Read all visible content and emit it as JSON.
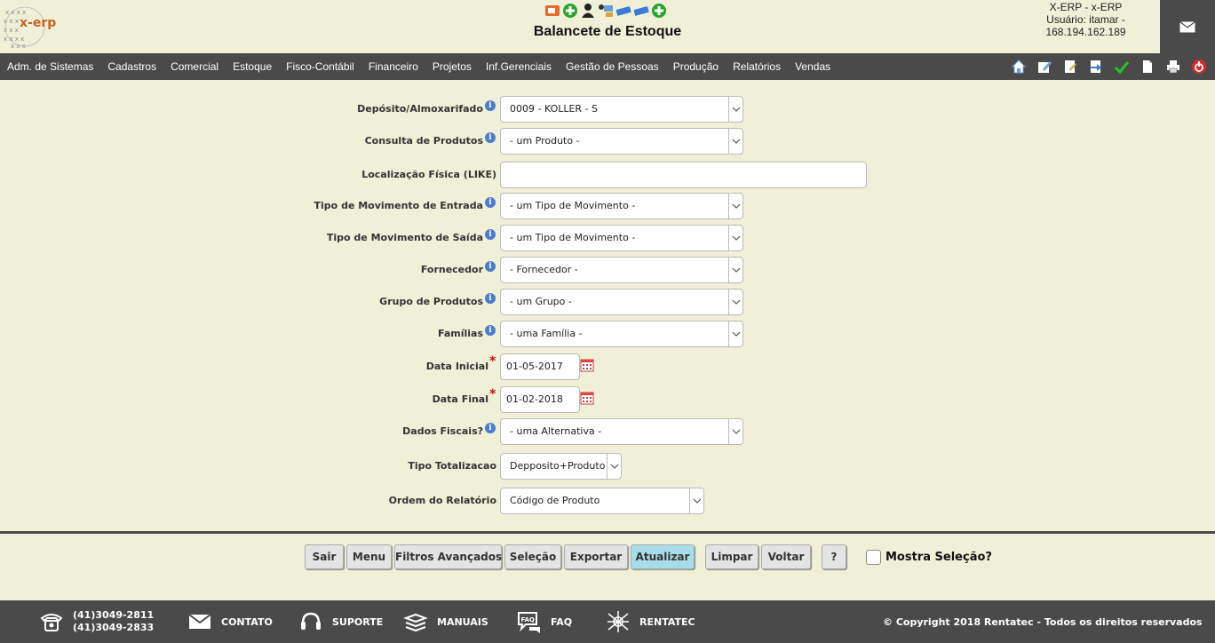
{
  "header": {
    "logo_text": "x-erp",
    "title": "Balancete de Estoque",
    "user_line1": "X-ERP - x-ERP",
    "user_line2": "Usuário: itamar -",
    "user_line3": "168.194.162.189"
  },
  "menu": {
    "items": [
      "Adm. de Sistemas",
      "Cadastros",
      "Comercial",
      "Estoque",
      "Fisco-Contábil",
      "Financeiro",
      "Projetos",
      "Inf.Gerenciais",
      "Gestão de Pessoas",
      "Produção",
      "Relatórios",
      "Vendas"
    ]
  },
  "form": {
    "deposito": {
      "label": "Depósito/Almoxarifado",
      "value": "0009 - KOLLER - S"
    },
    "consulta": {
      "label": "Consulta de Produtos",
      "value": "- um Produto -"
    },
    "localizacao": {
      "label": "Localização Física (LIKE)",
      "value": ""
    },
    "mov_entrada": {
      "label": "Tipo de Movimento de Entrada",
      "value": "- um Tipo de Movimento -"
    },
    "mov_saida": {
      "label": "Tipo de Movimento de Saída",
      "value": "- um Tipo de Movimento -"
    },
    "fornecedor": {
      "label": "Fornecedor",
      "value": "- Fornecedor -"
    },
    "grupo": {
      "label": "Grupo de Produtos",
      "value": "- um Grupo -"
    },
    "familias": {
      "label": "Famílias",
      "value": "- uma Família -"
    },
    "data_inicial": {
      "label": "Data Inicial",
      "value": "01-05-2017"
    },
    "data_final": {
      "label": "Data Final",
      "value": "01-02-2018"
    },
    "dados_fiscais": {
      "label": "Dados Fiscais?",
      "value": "- uma Alternativa -"
    },
    "tipo_totalizacao": {
      "label": "Tipo Totalizacao",
      "value": "Depposito+Produto"
    },
    "ordem": {
      "label": "Ordem do Relatório",
      "value": "Código de Produto"
    }
  },
  "buttons": {
    "sair": "Sair",
    "menu": "Menu",
    "filtros": "Filtros Avançados",
    "selecao": "Seleção",
    "exportar": "Exportar",
    "atualizar": "Atualizar",
    "limpar": "Limpar",
    "voltar": "Voltar",
    "help": "?",
    "mostra_selecao": "Mostra Seleção?"
  },
  "footer": {
    "phone1": "(41)3049-2811",
    "phone2": "(41)3049-2833",
    "contato": "CONTATO",
    "suporte": "SUPORTE",
    "manuais": "MANUAIS",
    "faq": "FAQ",
    "faq_icon_text": "FAQ",
    "rentatec": "RENTATEC",
    "copyright": "© Copyright 2018 Rentatec - Todos os direitos reservados"
  },
  "colors": {
    "background": "#f0f0d8",
    "bar": "#4a4a4a",
    "primary_button": "#a7dde8",
    "required": "#d01010",
    "info": "#4a7ccf"
  }
}
